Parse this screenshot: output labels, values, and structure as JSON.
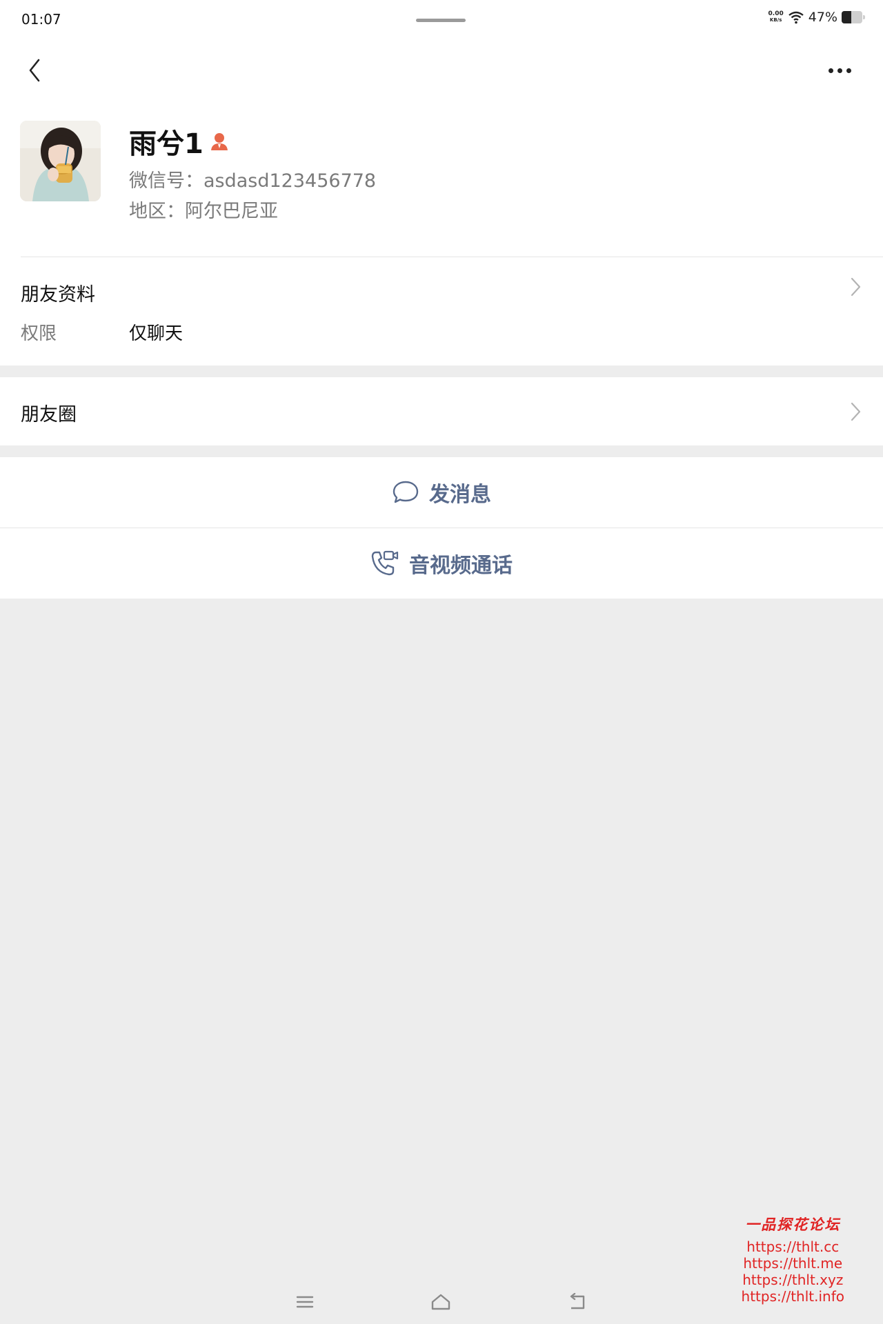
{
  "status_bar": {
    "time": "01:07",
    "net_speed_value": "0.00",
    "net_speed_unit": "KB/s",
    "battery_percent": "47%",
    "battery_level": 0.47
  },
  "nav": {
    "back_icon": "chevron-left-icon",
    "more_icon": "more-dots-icon"
  },
  "profile": {
    "name": "雨兮1",
    "wechat_id_line": "微信号：asdasd123456778",
    "region_line": "地区：阿尔巴尼亚",
    "badge_icon": "person-badge-icon",
    "badge_color": "#e8684a"
  },
  "friend_info": {
    "title": "朋友资料",
    "permission_label": "权限",
    "permission_value": "仅聊天"
  },
  "moments": {
    "title": "朋友圈"
  },
  "actions": {
    "send_message": "发消息",
    "av_call": "音视频通话",
    "accent_color": "#586a8c"
  },
  "watermark": {
    "title": "一品探花论坛",
    "urls": [
      "https://thlt.cc",
      "https://thlt.me",
      "https://thlt.xyz",
      "https://thlt.info"
    ]
  }
}
